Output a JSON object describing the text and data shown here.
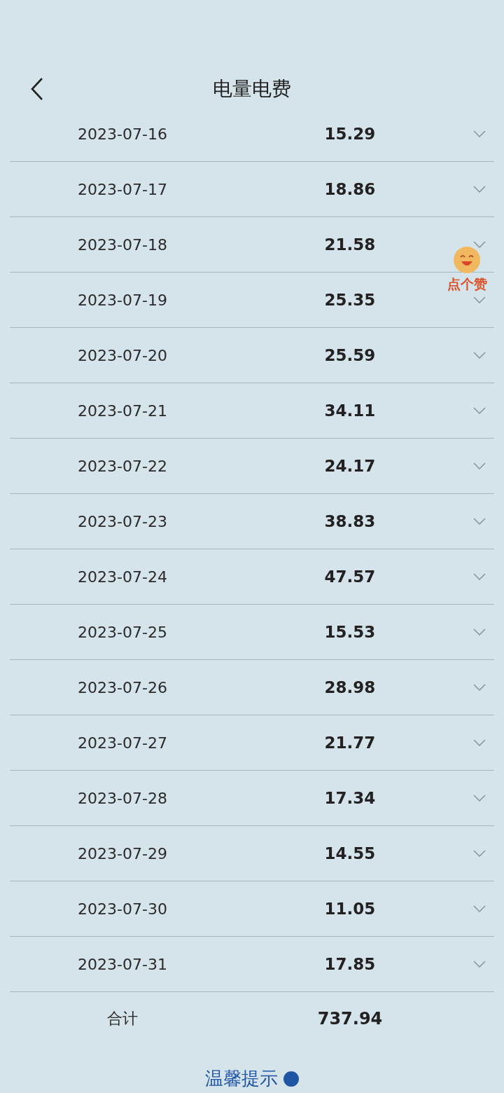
{
  "header": {
    "title": "电量电费"
  },
  "rows": [
    {
      "date": "2023-07-16",
      "amount": "15.29"
    },
    {
      "date": "2023-07-17",
      "amount": "18.86"
    },
    {
      "date": "2023-07-18",
      "amount": "21.58"
    },
    {
      "date": "2023-07-19",
      "amount": "25.35"
    },
    {
      "date": "2023-07-20",
      "amount": "25.59"
    },
    {
      "date": "2023-07-21",
      "amount": "34.11"
    },
    {
      "date": "2023-07-22",
      "amount": "24.17"
    },
    {
      "date": "2023-07-23",
      "amount": "38.83"
    },
    {
      "date": "2023-07-24",
      "amount": "47.57"
    },
    {
      "date": "2023-07-25",
      "amount": "15.53"
    },
    {
      "date": "2023-07-26",
      "amount": "28.98"
    },
    {
      "date": "2023-07-27",
      "amount": "21.77"
    },
    {
      "date": "2023-07-28",
      "amount": "17.34"
    },
    {
      "date": "2023-07-29",
      "amount": "14.55"
    },
    {
      "date": "2023-07-30",
      "amount": "11.05"
    },
    {
      "date": "2023-07-31",
      "amount": "17.85"
    }
  ],
  "total": {
    "label": "合计",
    "amount": "737.94"
  },
  "tip": {
    "label": "温馨提示"
  },
  "like_badge": {
    "label": "点个赞"
  }
}
